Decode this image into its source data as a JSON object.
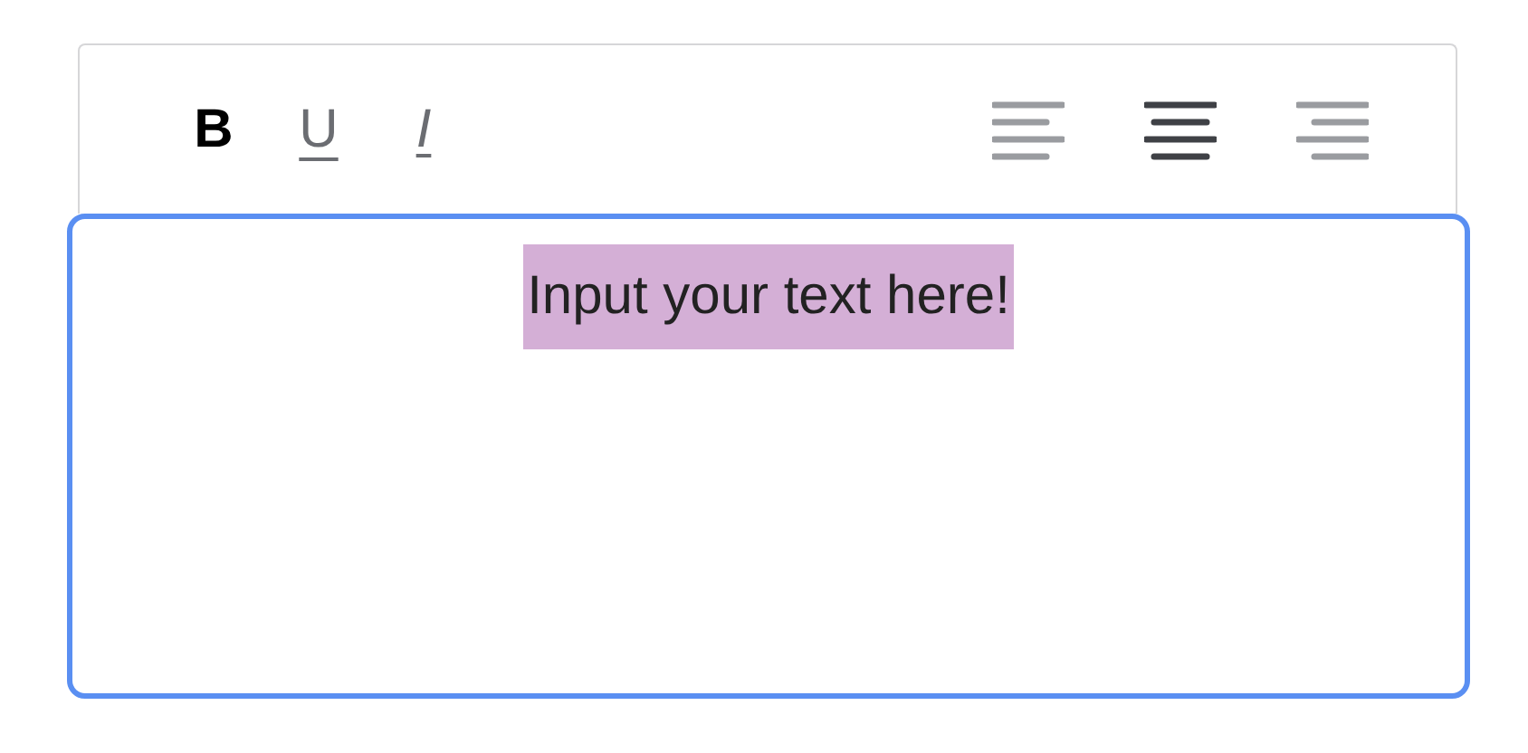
{
  "toolbar": {
    "format_buttons": [
      {
        "kind": "bold",
        "label": "B",
        "active": true
      },
      {
        "kind": "underline",
        "label": "U",
        "active": false
      },
      {
        "kind": "italic",
        "label": "I",
        "active": false
      }
    ],
    "align_buttons": [
      {
        "kind": "left",
        "selected": false
      },
      {
        "kind": "center",
        "selected": true
      },
      {
        "kind": "right",
        "selected": false
      }
    ]
  },
  "editor": {
    "value": "Input your text here!",
    "focused": true,
    "text_selected": true
  }
}
